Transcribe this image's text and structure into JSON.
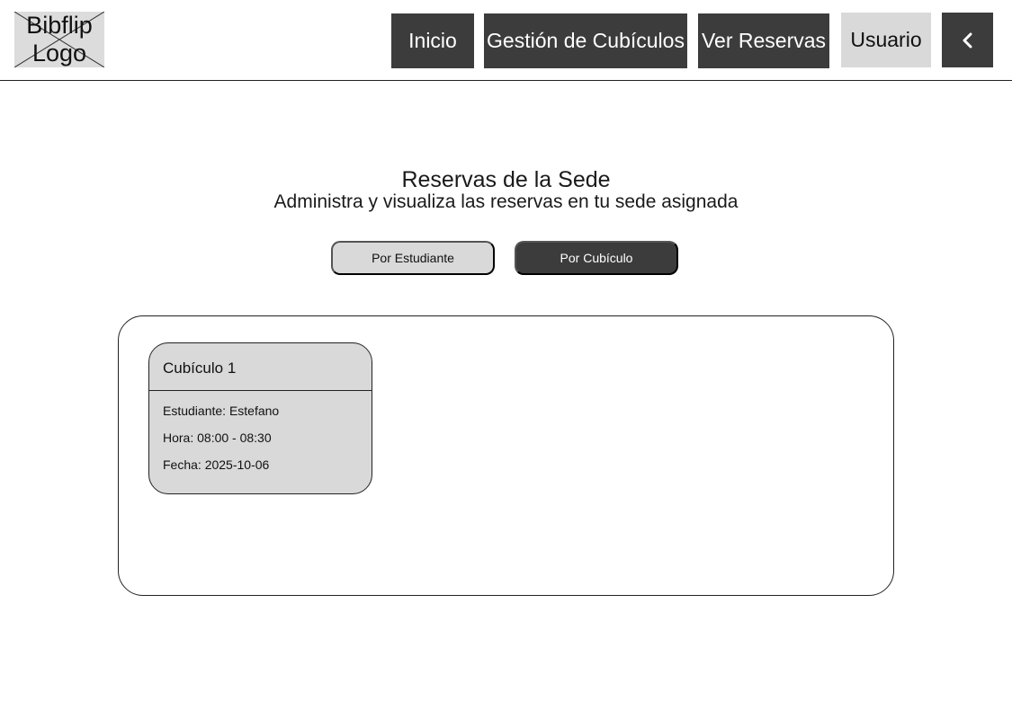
{
  "header": {
    "logo_text": "Bibflip Logo",
    "nav": {
      "inicio": "Inicio",
      "gestion": "Gestión de Cubículos",
      "reservas": "Ver Reservas",
      "usuario": "Usuario",
      "back_icon": "chevron-left-icon"
    }
  },
  "main": {
    "title": "Reservas de la Sede",
    "subtitle": "Administra y visualiza las reservas en tu sede asignada",
    "toggles": {
      "student": "Por Estudiante",
      "cubicle": "Por Cubículo",
      "active": "cubicle"
    },
    "cards": [
      {
        "title": "Cubículo 1",
        "student": "Estudiante: Estefano",
        "time": "Hora: 08:00 - 08:30",
        "date": "Fecha: 2025-10-06"
      }
    ]
  },
  "colors": {
    "dark": "#3c3c3c",
    "light": "#d9d9d9",
    "border": "#222222"
  }
}
